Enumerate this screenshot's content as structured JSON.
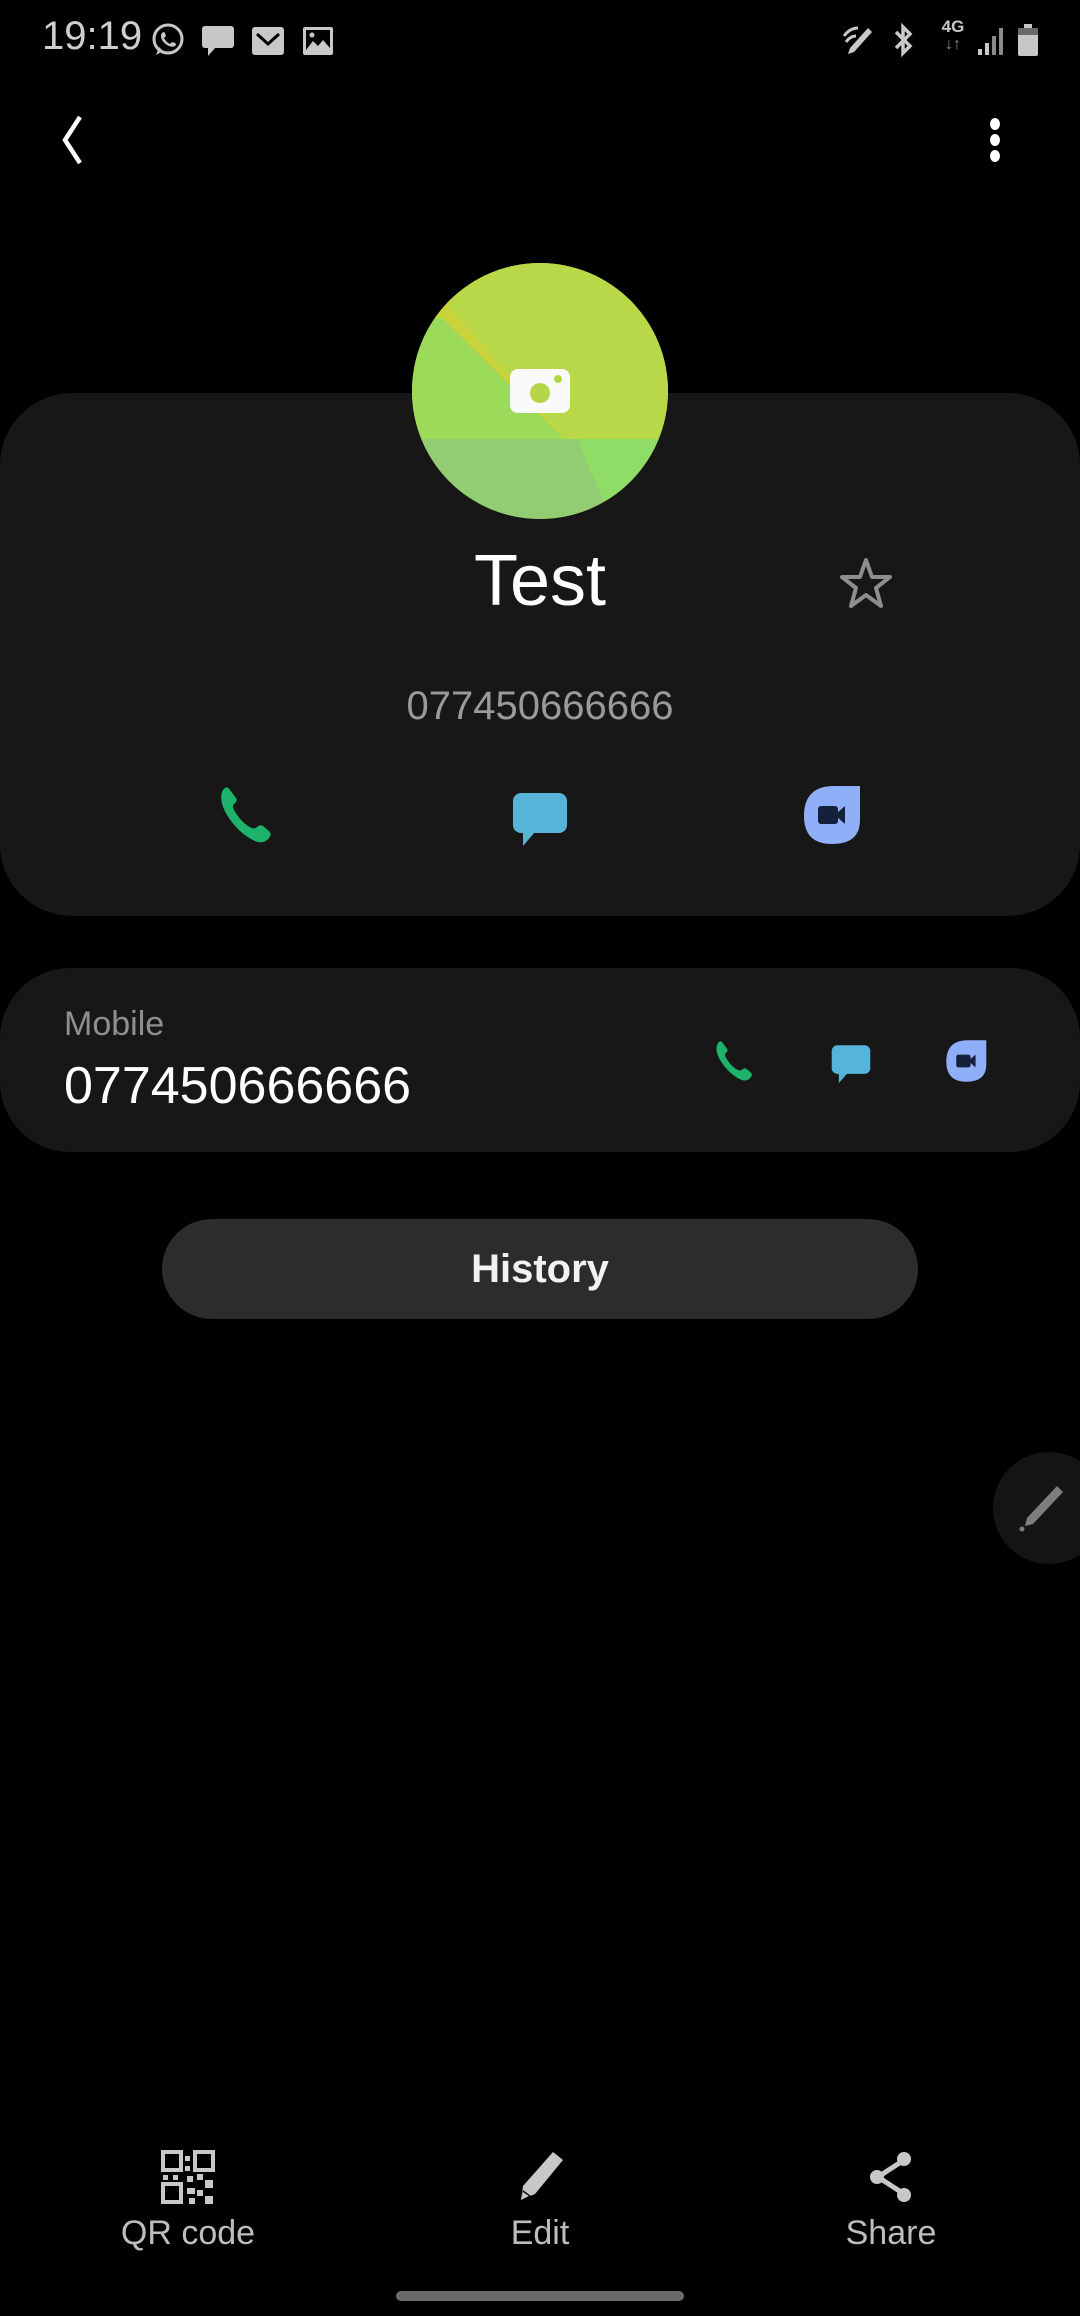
{
  "status_bar": {
    "time": "19:19",
    "left_icons": [
      "whatsapp-icon",
      "message-icon",
      "email-icon",
      "gallery-icon"
    ],
    "right_icons": [
      "s-pen-icon",
      "bluetooth-icon",
      "4g-data-icon",
      "signal-icon",
      "battery-icon"
    ],
    "network_label": "4G"
  },
  "top_bar": {
    "back_icon": "chevron-left-icon",
    "menu_icon": "more-vertical-icon"
  },
  "contact": {
    "name": "Test",
    "number": "077450666666",
    "favorite": false,
    "avatar_icon": "camera-icon",
    "avatar_colors": [
      "#c9d43a",
      "#b8d84a",
      "#9cda5a",
      "#92cc73",
      "#8fdc66"
    ]
  },
  "actions": [
    {
      "name": "call",
      "icon": "phone-icon",
      "color": "#1db36a"
    },
    {
      "name": "message",
      "icon": "message-icon",
      "color": "#56b4d8"
    },
    {
      "name": "video-call",
      "icon": "video-call-icon",
      "color": "#8fb0f8"
    }
  ],
  "numbers": [
    {
      "label": "Mobile",
      "value": "077450666666"
    }
  ],
  "history_button": {
    "label": "History"
  },
  "bottom_bar": {
    "items": [
      {
        "label": "QR code",
        "icon": "qr-code-icon"
      },
      {
        "label": "Edit",
        "icon": "pencil-icon"
      },
      {
        "label": "Share",
        "icon": "share-icon"
      }
    ]
  }
}
